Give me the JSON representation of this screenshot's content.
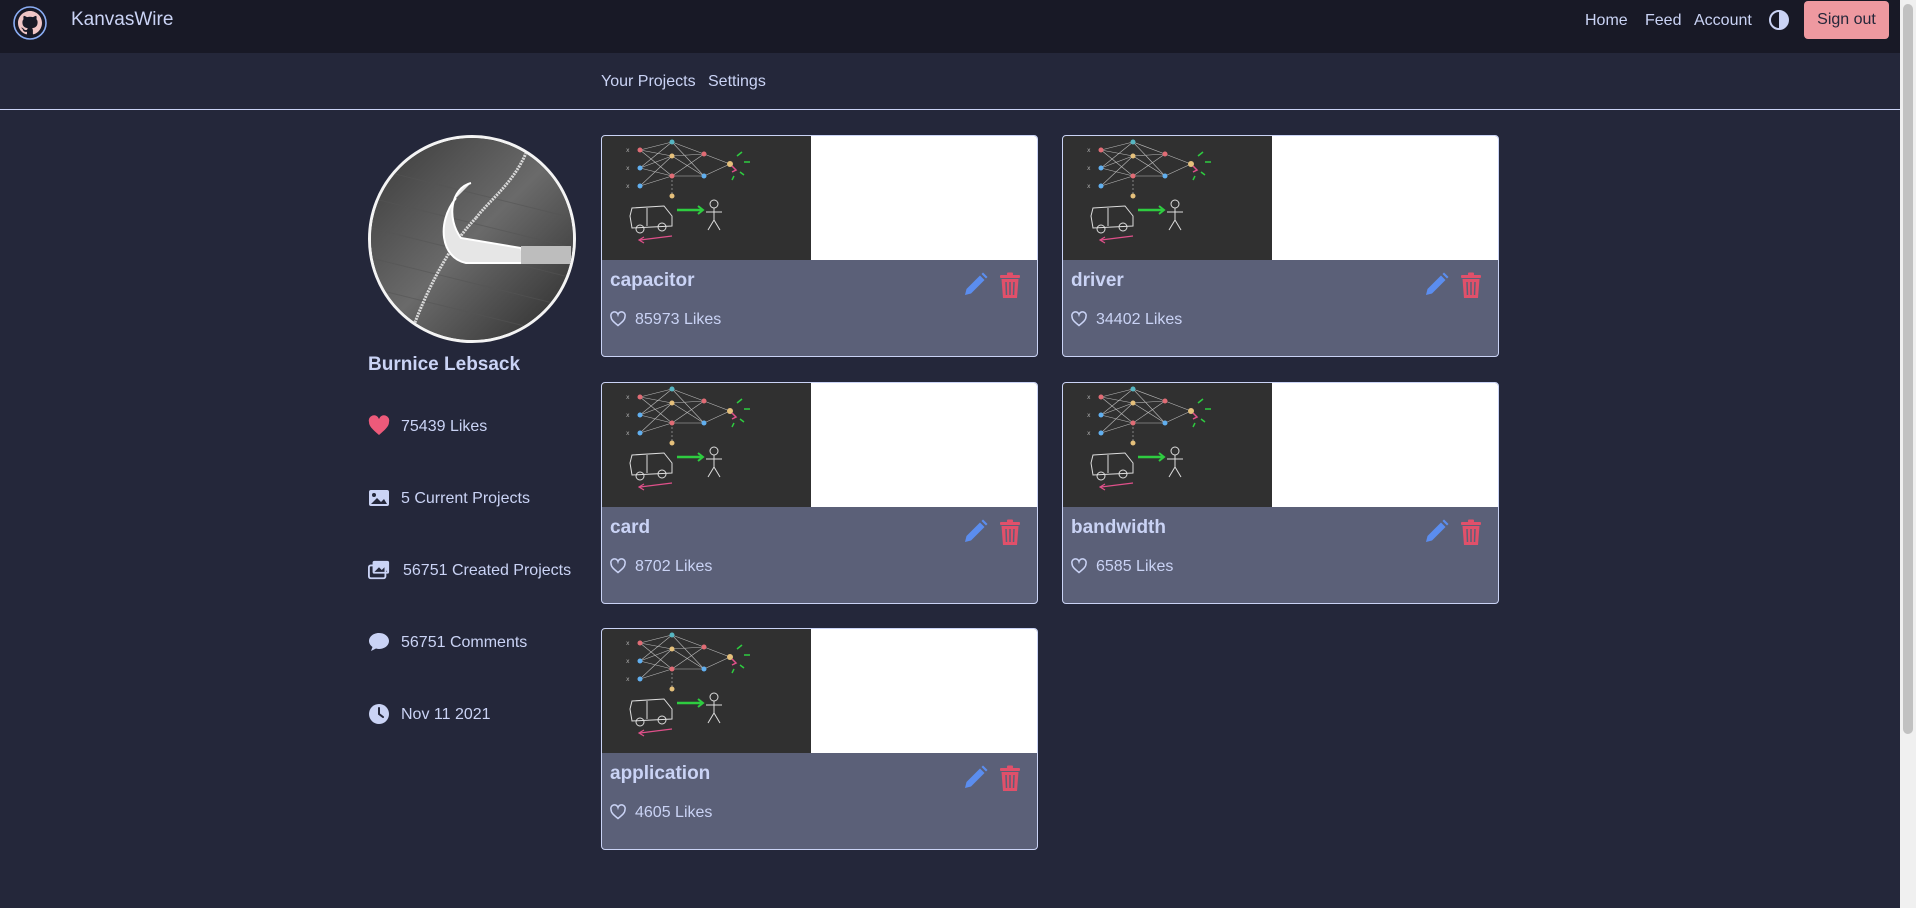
{
  "header": {
    "brand": "KanvasWire",
    "nav": {
      "home": "Home",
      "feed": "Feed",
      "account": "Account"
    },
    "sign_out": "Sign out",
    "logo_icon": "github-icon",
    "theme_icon": "contrast-icon"
  },
  "subnav": {
    "your_projects": "Your Projects",
    "settings": "Settings"
  },
  "profile": {
    "name": "Burnice Lebsack",
    "stats": {
      "likes": "75439 Likes",
      "current_projects": "5 Current Projects",
      "created_projects": "56751 Created Projects",
      "comments": "56751 Comments",
      "joined": "Nov 11 2021"
    }
  },
  "projects": [
    {
      "title": "capacitor",
      "likes": "85973 Likes"
    },
    {
      "title": "driver",
      "likes": "34402 Likes"
    },
    {
      "title": "card",
      "likes": "8702 Likes"
    },
    {
      "title": "bandwidth",
      "likes": "6585 Likes"
    },
    {
      "title": "application",
      "likes": "4605 Likes"
    }
  ],
  "colors": {
    "background": "#24273a",
    "navbar": "#181926",
    "card": "#5b6078",
    "text": "#cad3f5",
    "accent_pink": "#ee99a0",
    "heart_red": "#ed5a7a",
    "edit_blue": "#5b8def",
    "delete_red": "#e0506a"
  }
}
